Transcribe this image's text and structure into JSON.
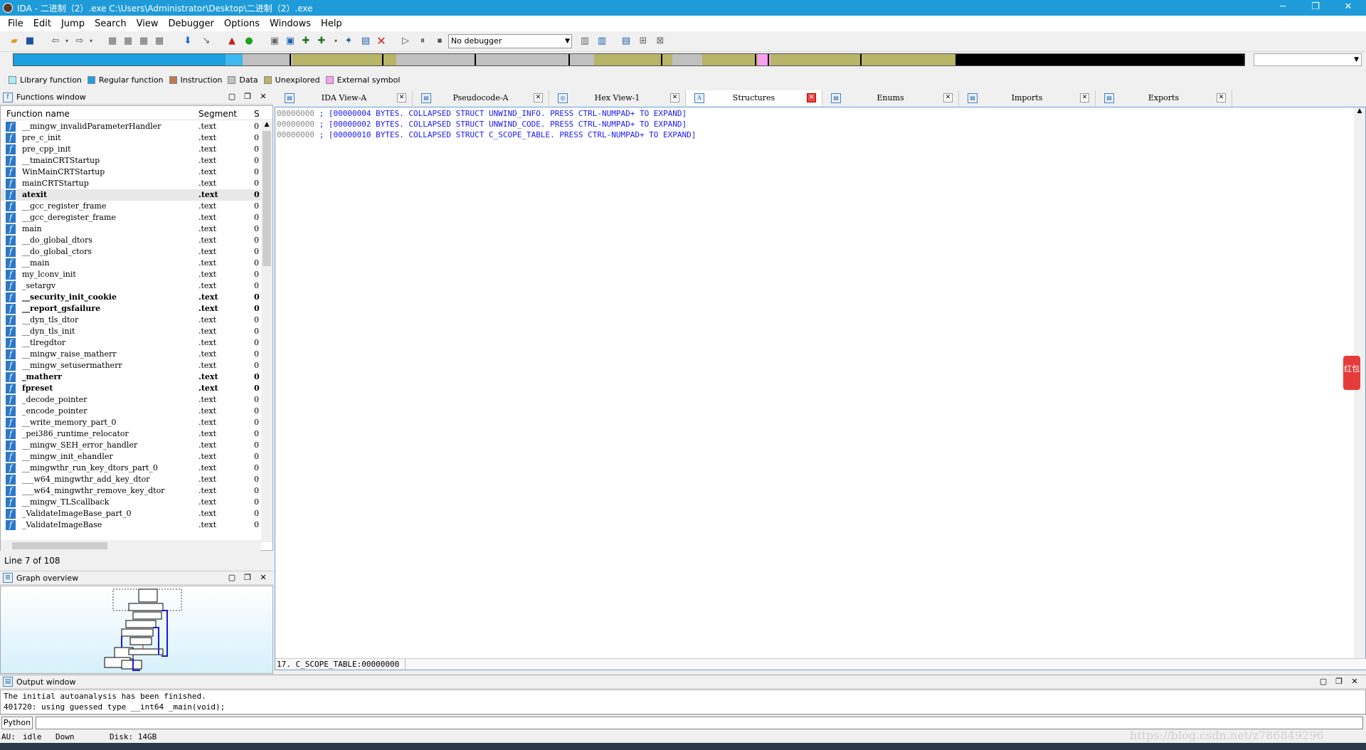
{
  "window": {
    "title": "IDA - 二进制（2）.exe C:\\Users\\Administrator\\Desktop\\二进制（2）.exe",
    "minimize": "─",
    "restore": "❐",
    "close": "✕"
  },
  "menu": [
    "File",
    "Edit",
    "Jump",
    "Search",
    "View",
    "Debugger",
    "Options",
    "Windows",
    "Help"
  ],
  "toolbar": {
    "debugger_select": "No debugger"
  },
  "legend": [
    {
      "label": "Library function",
      "color": "#a8f0f8"
    },
    {
      "label": "Regular function",
      "color": "#1ea0e0"
    },
    {
      "label": "Instruction",
      "color": "#c07850"
    },
    {
      "label": "Data",
      "color": "#c0c0c0"
    },
    {
      "label": "Unexplored",
      "color": "#b8b468"
    },
    {
      "label": "External symbol",
      "color": "#f8a0f0"
    }
  ],
  "functions_window": {
    "title": "Functions window",
    "col_name": "Function name",
    "col_segment": "Segment",
    "col_start": "S",
    "rows": [
      {
        "name": "__mingw_invalidParameterHandler",
        "seg": ".text",
        "s": "0",
        "bold": false
      },
      {
        "name": "pre_c_init",
        "seg": ".text",
        "s": "0",
        "bold": false
      },
      {
        "name": "pre_cpp_init",
        "seg": ".text",
        "s": "0",
        "bold": false
      },
      {
        "name": "__tmainCRTStartup",
        "seg": ".text",
        "s": "0",
        "bold": false
      },
      {
        "name": "WinMainCRTStartup",
        "seg": ".text",
        "s": "0",
        "bold": false
      },
      {
        "name": "mainCRTStartup",
        "seg": ".text",
        "s": "0",
        "bold": false
      },
      {
        "name": "atexit",
        "seg": ".text",
        "s": "0",
        "bold": true
      },
      {
        "name": "__gcc_register_frame",
        "seg": ".text",
        "s": "0",
        "bold": false
      },
      {
        "name": "__gcc_deregister_frame",
        "seg": ".text",
        "s": "0",
        "bold": false
      },
      {
        "name": "main",
        "seg": ".text",
        "s": "0",
        "bold": false
      },
      {
        "name": "__do_global_dtors",
        "seg": ".text",
        "s": "0",
        "bold": false
      },
      {
        "name": "__do_global_ctors",
        "seg": ".text",
        "s": "0",
        "bold": false
      },
      {
        "name": "__main",
        "seg": ".text",
        "s": "0",
        "bold": false
      },
      {
        "name": "my_lconv_init",
        "seg": ".text",
        "s": "0",
        "bold": false
      },
      {
        "name": "_setargv",
        "seg": ".text",
        "s": "0",
        "bold": false
      },
      {
        "name": "__security_init_cookie",
        "seg": ".text",
        "s": "0",
        "bold": true
      },
      {
        "name": "__report_gsfailure",
        "seg": ".text",
        "s": "0",
        "bold": true
      },
      {
        "name": "__dyn_tls_dtor",
        "seg": ".text",
        "s": "0",
        "bold": false
      },
      {
        "name": "__dyn_tls_init",
        "seg": ".text",
        "s": "0",
        "bold": false
      },
      {
        "name": "__tlregdtor",
        "seg": ".text",
        "s": "0",
        "bold": false
      },
      {
        "name": "__mingw_raise_matherr",
        "seg": ".text",
        "s": "0",
        "bold": false
      },
      {
        "name": "__mingw_setusermatherr",
        "seg": ".text",
        "s": "0",
        "bold": false
      },
      {
        "name": "_matherr",
        "seg": ".text",
        "s": "0",
        "bold": true
      },
      {
        "name": "fpreset",
        "seg": ".text",
        "s": "0",
        "bold": true
      },
      {
        "name": "_decode_pointer",
        "seg": ".text",
        "s": "0",
        "bold": false
      },
      {
        "name": "_encode_pointer",
        "seg": ".text",
        "s": "0",
        "bold": false
      },
      {
        "name": "__write_memory_part_0",
        "seg": ".text",
        "s": "0",
        "bold": false
      },
      {
        "name": "_pei386_runtime_relocator",
        "seg": ".text",
        "s": "0",
        "bold": false
      },
      {
        "name": "__mingw_SEH_error_handler",
        "seg": ".text",
        "s": "0",
        "bold": false
      },
      {
        "name": "__mingw_init_ehandler",
        "seg": ".text",
        "s": "0",
        "bold": false
      },
      {
        "name": "__mingwthr_run_key_dtors_part_0",
        "seg": ".text",
        "s": "0",
        "bold": false
      },
      {
        "name": "___w64_mingwthr_add_key_dtor",
        "seg": ".text",
        "s": "0",
        "bold": false
      },
      {
        "name": "___w64_mingwthr_remove_key_dtor",
        "seg": ".text",
        "s": "0",
        "bold": false
      },
      {
        "name": "__mingw_TLScallback",
        "seg": ".text",
        "s": "0",
        "bold": false
      },
      {
        "name": "_ValidateImageBase_part_0",
        "seg": ".text",
        "s": "0",
        "bold": false
      },
      {
        "name": "_ValidateImageBase",
        "seg": ".text",
        "s": "0",
        "bold": false
      }
    ],
    "line_status": "Line 7 of 108"
  },
  "graph_overview": {
    "title": "Graph overview"
  },
  "tabs": [
    {
      "label": "IDA View-A",
      "icon": "ida-view-icon",
      "active": false
    },
    {
      "label": "Pseudocode-A",
      "icon": "pseudocode-icon",
      "active": false
    },
    {
      "label": "Hex View-1",
      "icon": "hex-view-icon",
      "active": false
    },
    {
      "label": "Structures",
      "icon": "structures-icon",
      "active": true
    },
    {
      "label": "Enums",
      "icon": "enums-icon",
      "active": false
    },
    {
      "label": "Imports",
      "icon": "imports-icon",
      "active": false
    },
    {
      "label": "Exports",
      "icon": "exports-icon",
      "active": false
    }
  ],
  "structures": [
    {
      "addr": "00000000",
      "text": " ; [00000004 BYTES. COLLAPSED STRUCT UNWIND_INFO. PRESS CTRL-NUMPAD+ TO EXPAND]"
    },
    {
      "addr": "00000000",
      "text": " ; [00000002 BYTES. COLLAPSED STRUCT UNWIND_CODE. PRESS CTRL-NUMPAD+ TO EXPAND]"
    },
    {
      "addr": "00000000",
      "text": " ; [00000010 BYTES. COLLAPSED STRUCT C_SCOPE_TABLE. PRESS CTRL-NUMPAD+ TO EXPAND]"
    }
  ],
  "editor_status": "17. C_SCOPE_TABLE:00000000",
  "output_window": {
    "title": "Output window",
    "lines": [
      "The initial autoanalysis has been finished.",
      "401720: using guessed type __int64 _main(void);"
    ],
    "python_btn": "Python"
  },
  "statusbar": {
    "au": "AU:",
    "au_state": "idle",
    "direction": "Down",
    "disk": "Disk: 14GB"
  },
  "badge_text": "红包",
  "watermark": "https://blog.csdn.net/z786849296"
}
